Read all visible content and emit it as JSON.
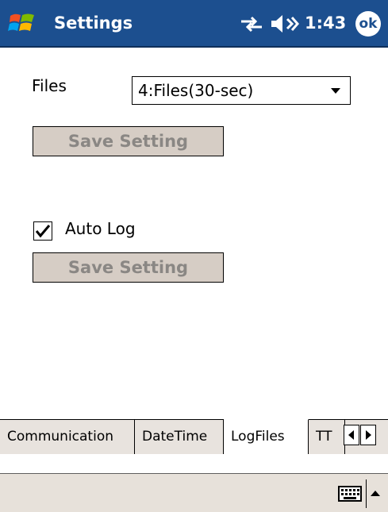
{
  "titlebar": {
    "title": "Settings",
    "time": "1:43",
    "ok_label": "ok",
    "icons": [
      "windows-start-icon",
      "connectivity-icon",
      "volume-icon"
    ]
  },
  "files": {
    "label": "Files",
    "selected": "4:Files(30-sec)"
  },
  "buttons": {
    "save_setting_1": "Save Setting",
    "save_setting_2": "Save Setting"
  },
  "auto_log": {
    "label": "Auto Log",
    "checked": true
  },
  "tabs": [
    {
      "label": "Communication",
      "active": false
    },
    {
      "label": "DateTime",
      "active": false
    },
    {
      "label": "LogFiles",
      "active": true
    },
    {
      "label": "TT",
      "active": false
    }
  ],
  "colors": {
    "titlebar": "#1c4f8f",
    "button_face": "#d6cdc5",
    "button_text_disabled": "#8a8784",
    "menubar": "#e7e1da"
  }
}
